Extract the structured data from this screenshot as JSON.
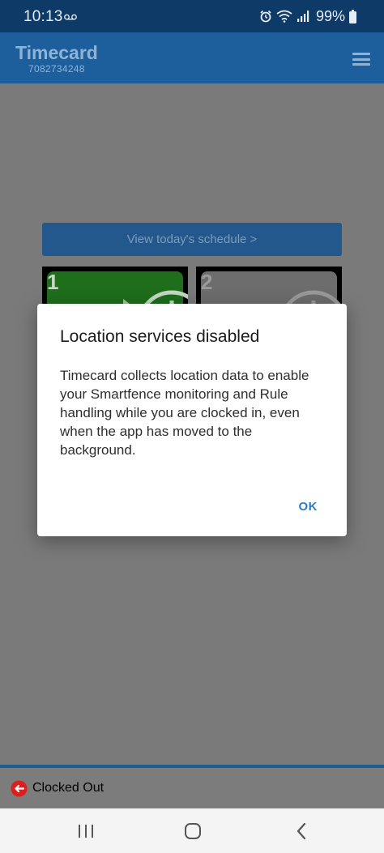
{
  "status_bar": {
    "time": "10:13",
    "battery": "99%",
    "icons": [
      "voicemail-icon",
      "alarm-icon",
      "wifi-icon",
      "signal-icon",
      "battery-icon"
    ]
  },
  "app_bar": {
    "title": "Timecard",
    "subtitle": "7082734248"
  },
  "main": {
    "schedule_button": "View today's schedule >",
    "tiles": [
      {
        "number": "1"
      },
      {
        "number": "2"
      }
    ]
  },
  "bottom_bar": {
    "status_label": "Clocked Out"
  },
  "dialog": {
    "title": "Location services disabled",
    "body": "Timecard collects location data to enable your Smartfence monitoring and Rule handling while you are clocked in, even when the app has moved to the background.",
    "ok_label": "OK"
  },
  "colors": {
    "status_bar": "#0d3a66",
    "app_bar": "#1c5f9c",
    "accent": "#2a7fc0",
    "tile_green": "#1f6e1c",
    "clocked_out_red": "#d8201e"
  }
}
